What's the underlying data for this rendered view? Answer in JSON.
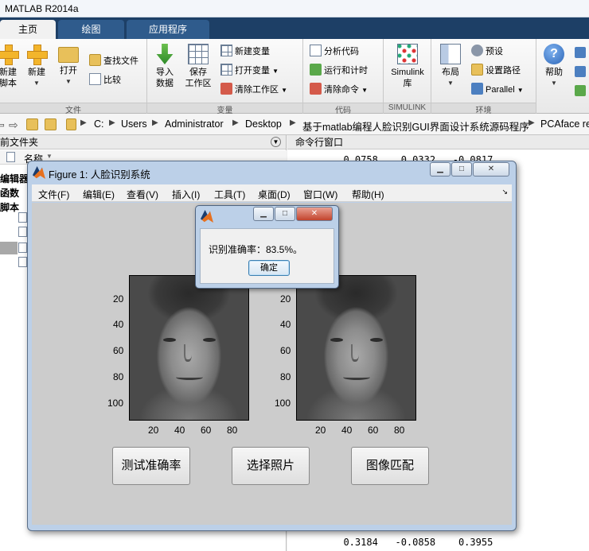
{
  "app": {
    "title": "MATLAB R2014a"
  },
  "ribbon": {
    "tabs": [
      {
        "label": "主页",
        "active": true
      },
      {
        "label": "绘图",
        "active": false
      },
      {
        "label": "应用程序",
        "active": false
      }
    ],
    "file_section": {
      "caption": "文件",
      "new_script": "新建\n脚本",
      "new": "新建",
      "open": "打开",
      "find_files": "查找文件",
      "compare": "比较"
    },
    "variable_section": {
      "caption": "变量",
      "import_data": "导入\n数据",
      "save_workspace": "保存\n工作区",
      "new_variable": "新建变量",
      "open_variable": "打开变量",
      "clear_workspace": "清除工作区"
    },
    "code_section": {
      "caption": "代码",
      "analyze_code": "分析代码",
      "run_and_time": "运行和计时",
      "clear_commands": "清除命令"
    },
    "simulink_section": {
      "caption": "SIMULINK",
      "simulink_library": "Simulink\n库"
    },
    "environment_section": {
      "caption": "环境",
      "layout": "布局",
      "preferences": "预设",
      "set_path": "设置路径",
      "parallel": "Parallel"
    },
    "resources_section": {
      "help": "帮助"
    }
  },
  "address_bar": {
    "path": [
      "C:",
      "Users",
      "Administrator",
      "Desktop",
      "基于matlab编程人脸识别GUI界面设计系统源码程序",
      "PCAface re"
    ]
  },
  "current_folder": {
    "title": "前文件夹",
    "column_name": "名称",
    "items": [
      "编辑器",
      "函数",
      "脚本"
    ]
  },
  "command_window": {
    "title": "命令行窗口",
    "lines": [
      "  0.0758    0.0332   -0.0817",
      "  0.3184   -0.0858    0.3955"
    ]
  },
  "figure": {
    "title": "Figure 1: 人脸识别系统",
    "menus": [
      "文件(F)",
      "编辑(E)",
      "查看(V)",
      "插入(I)",
      "工具(T)",
      "桌面(D)",
      "窗口(W)",
      "帮助(H)"
    ],
    "axes_left": {
      "yticks": [
        "20",
        "40",
        "60",
        "80",
        "100"
      ],
      "xticks": [
        "20",
        "40",
        "60",
        "80"
      ]
    },
    "axes_right": {
      "yticks": [
        "20",
        "40",
        "60",
        "80",
        "100"
      ],
      "xticks": [
        "20",
        "40",
        "60",
        "80"
      ]
    },
    "buttons": {
      "test_accuracy": "测试准确率",
      "select_photo": "选择照片",
      "image_match": "图像匹配"
    }
  },
  "dialog": {
    "message": "识别准确率：83.5%。",
    "ok": "确定"
  }
}
